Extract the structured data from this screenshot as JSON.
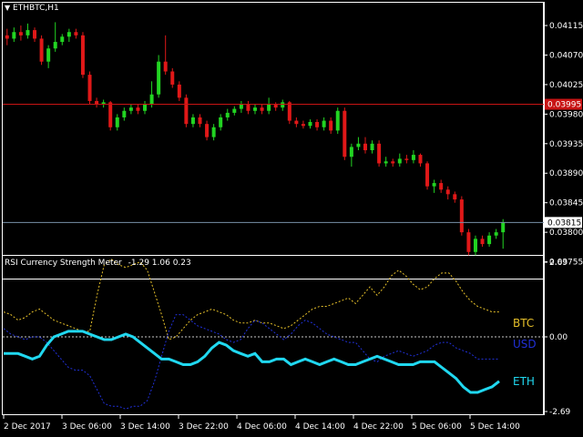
{
  "symbol_title": "ETHBTC,H1",
  "price_axis": {
    "ticks": [
      "0.04115",
      "0.04070",
      "0.04025",
      "0.03980",
      "0.03935",
      "0.03890",
      "0.03845",
      "0.03800",
      "0.03755"
    ],
    "tick_values": [
      0.04115,
      0.0407,
      0.04025,
      0.0398,
      0.03935,
      0.0389,
      0.03845,
      0.038,
      0.03755
    ],
    "red_line_label": "0.03995",
    "red_line_value": 0.03995,
    "bid_line_label": "0.03815",
    "bid_line_value": 0.03815,
    "range": [
      0.03735,
      0.0414
    ]
  },
  "time_axis": {
    "labels": [
      "2 Dec 2017",
      "3 Dec 06:00",
      "3 Dec 14:00",
      "3 Dec 22:00",
      "4 Dec 06:00",
      "4 Dec 14:00",
      "4 Dec 22:00",
      "5 Dec 06:00",
      "5 Dec 14:00"
    ]
  },
  "indicator": {
    "title": "RSI Currency Strength Meter",
    "values_text": "-1.29 1.06 0.23",
    "scale": [
      "2.69",
      "0.00",
      "-2.69"
    ],
    "scale_values": [
      2.69,
      0,
      -2.69
    ],
    "legend": [
      {
        "name": "BTC",
        "color": "#e6c02a"
      },
      {
        "name": "USD",
        "color": "#2030d8"
      },
      {
        "name": "ETH",
        "color": "#20d8f0"
      }
    ]
  },
  "colors": {
    "bull": "#22d422",
    "bear": "#e01818",
    "red_line": "#c81414",
    "bid_line": "#7890a8",
    "axis": "#ffffff"
  },
  "chart_data": [
    {
      "type": "candlestick",
      "title": "ETHBTC,H1",
      "ylim": [
        0.03735,
        0.0414
      ],
      "candles": [
        [
          0.041,
          0.04095,
          0.0411,
          0.04085
        ],
        [
          0.04095,
          0.04105,
          0.04112,
          0.0409
        ],
        [
          0.04105,
          0.041,
          0.04115,
          0.04092
        ],
        [
          0.041,
          0.04108,
          0.04118,
          0.04095
        ],
        [
          0.04108,
          0.04095,
          0.04112,
          0.0409
        ],
        [
          0.04095,
          0.0406,
          0.041,
          0.04055
        ],
        [
          0.0406,
          0.0408,
          0.04085,
          0.0405
        ],
        [
          0.0408,
          0.0409,
          0.0412,
          0.04075
        ],
        [
          0.0409,
          0.04098,
          0.04102,
          0.04085
        ],
        [
          0.04098,
          0.04105,
          0.0411,
          0.0409
        ],
        [
          0.04105,
          0.041,
          0.0411,
          0.04095
        ],
        [
          0.041,
          0.0404,
          0.04105,
          0.04035
        ],
        [
          0.0404,
          0.04,
          0.04045,
          0.03995
        ],
        [
          0.04,
          0.03995,
          0.04005,
          0.0399
        ],
        [
          0.03995,
          0.03998,
          0.04002,
          0.0399
        ],
        [
          0.03998,
          0.0396,
          0.04,
          0.03955
        ],
        [
          0.0396,
          0.03975,
          0.0398,
          0.03955
        ],
        [
          0.03975,
          0.03985,
          0.0399,
          0.0397
        ],
        [
          0.03985,
          0.0399,
          0.03995,
          0.0398
        ],
        [
          0.0399,
          0.03985,
          0.03995,
          0.0398
        ],
        [
          0.03985,
          0.03995,
          0.04,
          0.0398
        ],
        [
          0.03995,
          0.0401,
          0.0403,
          0.0399
        ],
        [
          0.0401,
          0.0406,
          0.0407,
          0.04005
        ],
        [
          0.0406,
          0.04045,
          0.041,
          0.0404
        ],
        [
          0.04045,
          0.04025,
          0.0405,
          0.0402
        ],
        [
          0.04025,
          0.04005,
          0.0403,
          0.04
        ],
        [
          0.04005,
          0.03965,
          0.0401,
          0.0396
        ],
        [
          0.03965,
          0.03975,
          0.0398,
          0.0396
        ],
        [
          0.03975,
          0.03965,
          0.0398,
          0.0396
        ],
        [
          0.03965,
          0.03945,
          0.0397,
          0.0394
        ],
        [
          0.03945,
          0.0396,
          0.03965,
          0.0394
        ],
        [
          0.0396,
          0.03975,
          0.0398,
          0.03955
        ],
        [
          0.03975,
          0.03982,
          0.03988,
          0.0397
        ],
        [
          0.03982,
          0.03988,
          0.03992,
          0.03978
        ],
        [
          0.03988,
          0.03995,
          0.04,
          0.03982
        ],
        [
          0.03995,
          0.03985,
          0.04,
          0.0398
        ],
        [
          0.03985,
          0.0399,
          0.03995,
          0.0398
        ],
        [
          0.0399,
          0.03985,
          0.03995,
          0.0398
        ],
        [
          0.03985,
          0.03995,
          0.04005,
          0.0398
        ],
        [
          0.03995,
          0.0399,
          0.03998,
          0.03985
        ],
        [
          0.0399,
          0.03998,
          0.04002,
          0.03985
        ],
        [
          0.03998,
          0.0397,
          0.04,
          0.03965
        ],
        [
          0.0397,
          0.03965,
          0.03975,
          0.0396
        ],
        [
          0.03965,
          0.03962,
          0.0397,
          0.03958
        ],
        [
          0.03962,
          0.03968,
          0.03972,
          0.03958
        ],
        [
          0.03968,
          0.0396,
          0.03972,
          0.03955
        ],
        [
          0.0396,
          0.0397,
          0.03975,
          0.03955
        ],
        [
          0.0397,
          0.03955,
          0.03975,
          0.0395
        ],
        [
          0.03955,
          0.03985,
          0.0399,
          0.0395
        ],
        [
          0.03985,
          0.03915,
          0.0399,
          0.0391
        ],
        [
          0.03915,
          0.0393,
          0.03935,
          0.039
        ],
        [
          0.0393,
          0.03935,
          0.03945,
          0.03925
        ],
        [
          0.03935,
          0.03925,
          0.03945,
          0.0392
        ],
        [
          0.03925,
          0.03935,
          0.0394,
          0.0392
        ],
        [
          0.03935,
          0.03905,
          0.0394,
          0.039
        ],
        [
          0.03905,
          0.03908,
          0.03915,
          0.039
        ],
        [
          0.03908,
          0.03905,
          0.03912,
          0.039
        ],
        [
          0.03905,
          0.03912,
          0.0392,
          0.039
        ],
        [
          0.03912,
          0.0391,
          0.03918,
          0.03905
        ],
        [
          0.0391,
          0.03918,
          0.03925,
          0.03905
        ],
        [
          0.03918,
          0.03905,
          0.0392,
          0.039
        ],
        [
          0.03905,
          0.0387,
          0.03908,
          0.03865
        ],
        [
          0.0387,
          0.03875,
          0.0388,
          0.0386
        ],
        [
          0.03875,
          0.03865,
          0.0388,
          0.0386
        ],
        [
          0.03865,
          0.03858,
          0.0387,
          0.0385
        ],
        [
          0.03858,
          0.0385,
          0.03862,
          0.03845
        ],
        [
          0.0385,
          0.038,
          0.03855,
          0.03795
        ],
        [
          0.038,
          0.0377,
          0.03805,
          0.03765
        ],
        [
          0.0377,
          0.0379,
          0.03795,
          0.03765
        ],
        [
          0.0379,
          0.03782,
          0.03795,
          0.03778
        ],
        [
          0.03782,
          0.03795,
          0.038,
          0.03778
        ],
        [
          0.03795,
          0.038,
          0.03805,
          0.0379
        ],
        [
          0.038,
          0.03815,
          0.0382,
          0.03775
        ]
      ]
    },
    {
      "type": "line",
      "title": "RSI Currency Strength Meter",
      "ylim": [
        -2.69,
        2.69
      ],
      "series": [
        {
          "name": "BTC",
          "values": [
            0.9,
            0.8,
            0.6,
            0.7,
            0.9,
            1.0,
            0.8,
            0.6,
            0.5,
            0.4,
            0.3,
            0.2,
            0.2,
            1.5,
            2.6,
            2.8,
            2.6,
            2.5,
            2.6,
            2.7,
            2.4,
            1.6,
            0.8,
            -0.1,
            0.0,
            0.3,
            0.6,
            0.8,
            0.9,
            1.0,
            0.9,
            0.8,
            0.6,
            0.5,
            0.5,
            0.6,
            0.5,
            0.5,
            0.4,
            0.3,
            0.4,
            0.6,
            0.8,
            1.0,
            1.1,
            1.1,
            1.2,
            1.3,
            1.4,
            1.2,
            1.5,
            1.8,
            1.5,
            1.8,
            2.2,
            2.4,
            2.2,
            1.9,
            1.7,
            1.8,
            2.1,
            2.3,
            2.3,
            2.0,
            1.6,
            1.3,
            1.1,
            1.0,
            0.9,
            0.9
          ]
        },
        {
          "name": "USD",
          "values": [
            0.3,
            0.1,
            0.0,
            -0.1,
            0.0,
            0.0,
            -0.2,
            -0.5,
            -0.8,
            -1.1,
            -1.2,
            -1.2,
            -1.4,
            -1.9,
            -2.4,
            -2.5,
            -2.5,
            -2.6,
            -2.5,
            -2.5,
            -2.3,
            -1.6,
            -0.7,
            0.2,
            0.8,
            0.8,
            0.6,
            0.4,
            0.3,
            0.2,
            0.1,
            -0.1,
            -0.2,
            -0.1,
            0.3,
            0.6,
            0.5,
            0.3,
            0.1,
            -0.1,
            0.1,
            0.4,
            0.6,
            0.5,
            0.3,
            0.1,
            0.0,
            -0.1,
            -0.2,
            -0.2,
            -0.5,
            -0.8,
            -0.9,
            -0.7,
            -0.6,
            -0.5,
            -0.6,
            -0.7,
            -0.6,
            -0.5,
            -0.3,
            -0.2,
            -0.2,
            -0.4,
            -0.5,
            -0.6,
            -0.8,
            -0.8,
            -0.8,
            -0.8
          ]
        },
        {
          "name": "ETH",
          "values": [
            -0.6,
            -0.6,
            -0.6,
            -0.7,
            -0.8,
            -0.7,
            -0.3,
            0.0,
            0.1,
            0.2,
            0.2,
            0.2,
            0.1,
            0.0,
            -0.1,
            -0.1,
            0.0,
            0.1,
            0.0,
            -0.2,
            -0.4,
            -0.6,
            -0.8,
            -0.8,
            -0.9,
            -1.0,
            -1.0,
            -0.9,
            -0.7,
            -0.4,
            -0.2,
            -0.3,
            -0.5,
            -0.6,
            -0.7,
            -0.6,
            -0.9,
            -0.9,
            -0.8,
            -0.8,
            -1.0,
            -0.9,
            -0.8,
            -0.9,
            -1.0,
            -0.9,
            -0.8,
            -0.9,
            -1.0,
            -1.0,
            -0.9,
            -0.8,
            -0.7,
            -0.8,
            -0.9,
            -1.0,
            -1.0,
            -1.0,
            -0.9,
            -0.9,
            -0.9,
            -1.1,
            -1.3,
            -1.5,
            -1.8,
            -2.0,
            -2.0,
            -1.9,
            -1.8,
            -1.6
          ]
        }
      ]
    }
  ]
}
